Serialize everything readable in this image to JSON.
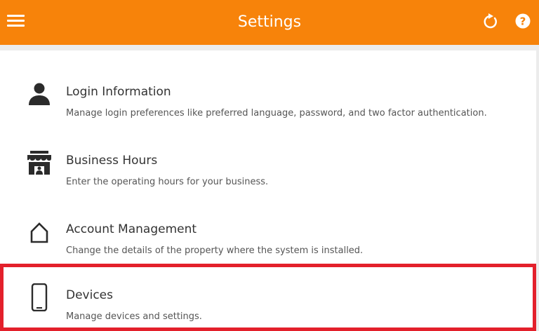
{
  "header": {
    "title": "Settings",
    "menu_icon": "hamburger-menu-icon",
    "refresh_icon": "refresh-icon",
    "help_icon": "help-icon",
    "brand_color": "#f7830a"
  },
  "settings": {
    "items": [
      {
        "label": "Login Information",
        "description": "Manage login preferences like preferred language, password, and two factor authentication.",
        "icon": "user-icon"
      },
      {
        "label": "Business Hours",
        "description": "Enter the operating hours for your business.",
        "icon": "storefront-icon"
      },
      {
        "label": "Account Management",
        "description": "Change the details of the property where the system is installed.",
        "icon": "home-icon"
      },
      {
        "label": "Devices",
        "description": "Manage devices and settings.",
        "icon": "smartphone-icon"
      }
    ],
    "highlight_color": "#e3202b"
  }
}
